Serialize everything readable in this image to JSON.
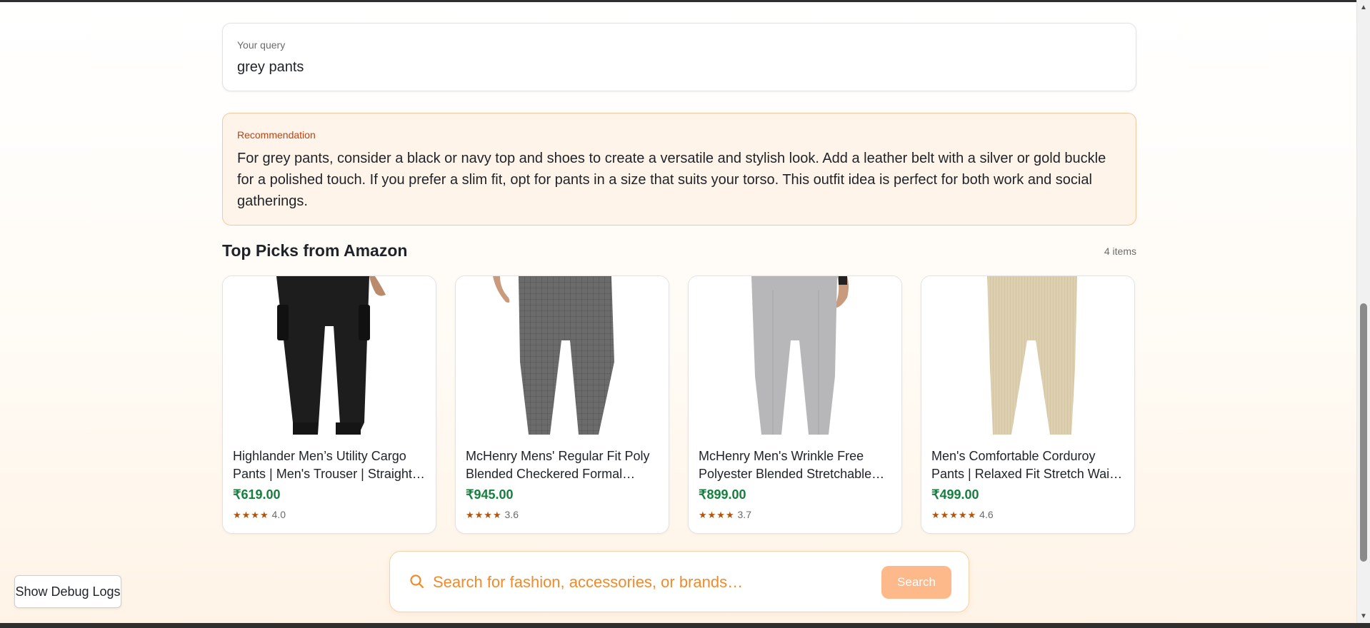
{
  "query": {
    "label": "Your query",
    "value": "grey pants"
  },
  "recommendation": {
    "label": "Recommendation",
    "text": "For grey pants, consider a black or navy top and shoes to create a versatile and stylish look. Add a leather belt with a silver or gold buckle for a polished touch. If you prefer a slim fit, opt for pants in a size that suits your torso. This outfit idea is perfect for both work and social gatherings."
  },
  "section": {
    "title": "Top Picks from Amazon",
    "count": "4 items"
  },
  "products": [
    {
      "title": "Highlander Men’s Utility Cargo Pants | Men's Trouser | Straight Fit Cargo Pants",
      "price": "₹619.00",
      "stars": "★★★★",
      "rating": "4.0",
      "pant_color": "#1d1d1d"
    },
    {
      "title": "McHenry Mens' Regular Fit Poly Blended Checkered Formal Trousers",
      "price": "₹945.00",
      "stars": "★★★★",
      "rating": "3.6",
      "pant_color": "#6b6b6b"
    },
    {
      "title": "McHenry Men's Wrinkle Free Polyester Blended Stretchable Formal Trousers",
      "price": "₹899.00",
      "stars": "★★★★",
      "rating": "3.7",
      "pant_color": "#b7b7ba"
    },
    {
      "title": "Men's Comfortable Corduroy Pants | Relaxed Fit Stretch Waist Trousers",
      "price": "₹499.00",
      "stars": "★★★★★",
      "rating": "4.6",
      "pant_color": "#ddd0b0"
    }
  ],
  "search": {
    "placeholder": "Search for fashion, accessories, or brands…",
    "button": "Search",
    "icon": "search-icon"
  },
  "debug": {
    "label": "Show Debug Logs"
  },
  "colors": {
    "accent": "#ef8b2c",
    "price": "#15803d",
    "recommendation_bg": "#fff4ea",
    "button_bg": "#fdb98a"
  }
}
